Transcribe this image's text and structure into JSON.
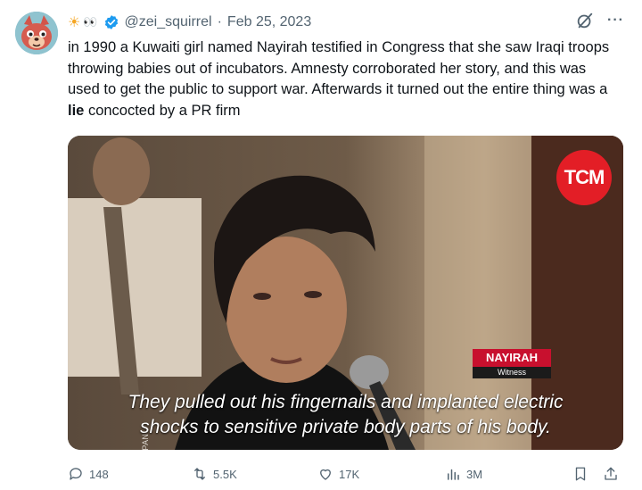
{
  "tweet": {
    "handle": "@zei_squirrel",
    "separator": "·",
    "date": "Feb 25, 2023",
    "emoji": "☀",
    "eyes": "👀",
    "text_before": "in 1990 a Kuwaiti girl named Nayirah testified in Congress that she saw Iraqi troops throwing babies out of incubators. Amnesty corroborated her story, and this was used to get the public to support war. Afterwards it turned out the entire thing was a ",
    "text_bold": "lie",
    "text_after": " concocted by a PR firm",
    "more": "···"
  },
  "media": {
    "logo": "TCM",
    "nameplate_name": "NAYIRAH",
    "nameplate_role": "Witness",
    "footage_credit": "FOOTAGE: C-SPAN",
    "caption_line1": "They pulled out his fingernails and implanted electric",
    "caption_line2": "shocks to sensitive private body parts of his body."
  },
  "actions": {
    "replies": "148",
    "reposts": "5.5K",
    "likes": "17K",
    "views": "3M"
  },
  "colors": {
    "secondary_text": "#536471",
    "verified_blue": "#1d9bf0",
    "tcm_red": "#e31e26"
  }
}
